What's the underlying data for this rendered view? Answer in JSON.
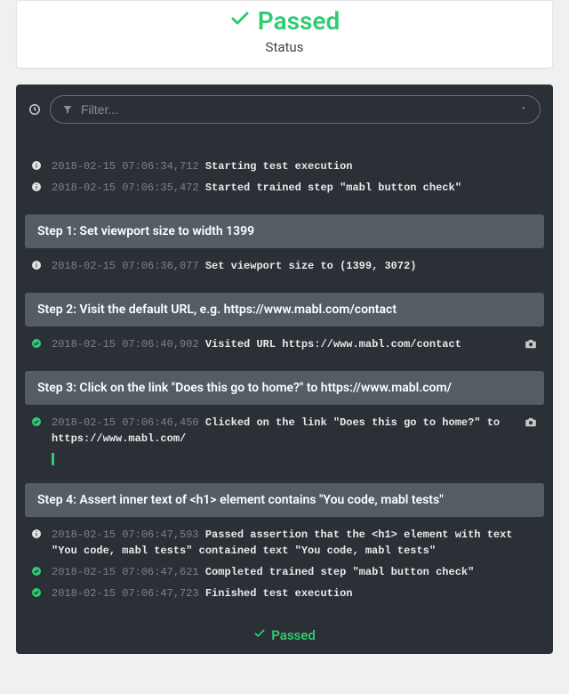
{
  "status": {
    "label": "Passed",
    "sublabel": "Status"
  },
  "filter": {
    "placeholder": "Filter..."
  },
  "prelude": [
    {
      "icon": "info",
      "ts": "2018-02-15 07:06:34,712",
      "msg": "Starting test execution"
    },
    {
      "icon": "info",
      "ts": "2018-02-15 07:06:35,472",
      "msg": "Started trained step \"mabl button check\""
    }
  ],
  "steps": [
    {
      "title": "Step 1: Set viewport size to width 1399",
      "lines": [
        {
          "icon": "info",
          "ts": "2018-02-15 07:06:36,077",
          "msg": "Set viewport size to (1399, 3072)",
          "camera": false
        }
      ]
    },
    {
      "title": "Step 2: Visit the default URL, e.g. https://www.mabl.com/contact",
      "lines": [
        {
          "icon": "ok",
          "ts": "2018-02-15 07:06:40,902",
          "msg": "Visited URL https://www.mabl.com/contact",
          "camera": true
        }
      ]
    },
    {
      "title": "Step 3: Click on the link \"Does this go to home?\" to https://www.mabl.com/",
      "lines": [
        {
          "icon": "ok",
          "ts": "2018-02-15 07:06:46,450",
          "msg": "Clicked on the link \"Does this go to home?\" to https://www.mabl.com/",
          "camera": true,
          "substep": true
        }
      ]
    },
    {
      "title": "Step 4: Assert inner text of <h1> element contains \"You code, mabl tests\"",
      "lines": [
        {
          "icon": "info",
          "ts": "2018-02-15 07:06:47,593",
          "msg": "Passed assertion that the <h1> element with text \"You code, mabl tests\" contained text \"You code, mabl tests\""
        },
        {
          "icon": "ok",
          "ts": "2018-02-15 07:06:47,621",
          "msg": "Completed trained step \"mabl button check\""
        },
        {
          "icon": "ok",
          "ts": "2018-02-15 07:06:47,723",
          "msg": "Finished test execution"
        }
      ]
    }
  ],
  "footer": {
    "label": "Passed"
  }
}
